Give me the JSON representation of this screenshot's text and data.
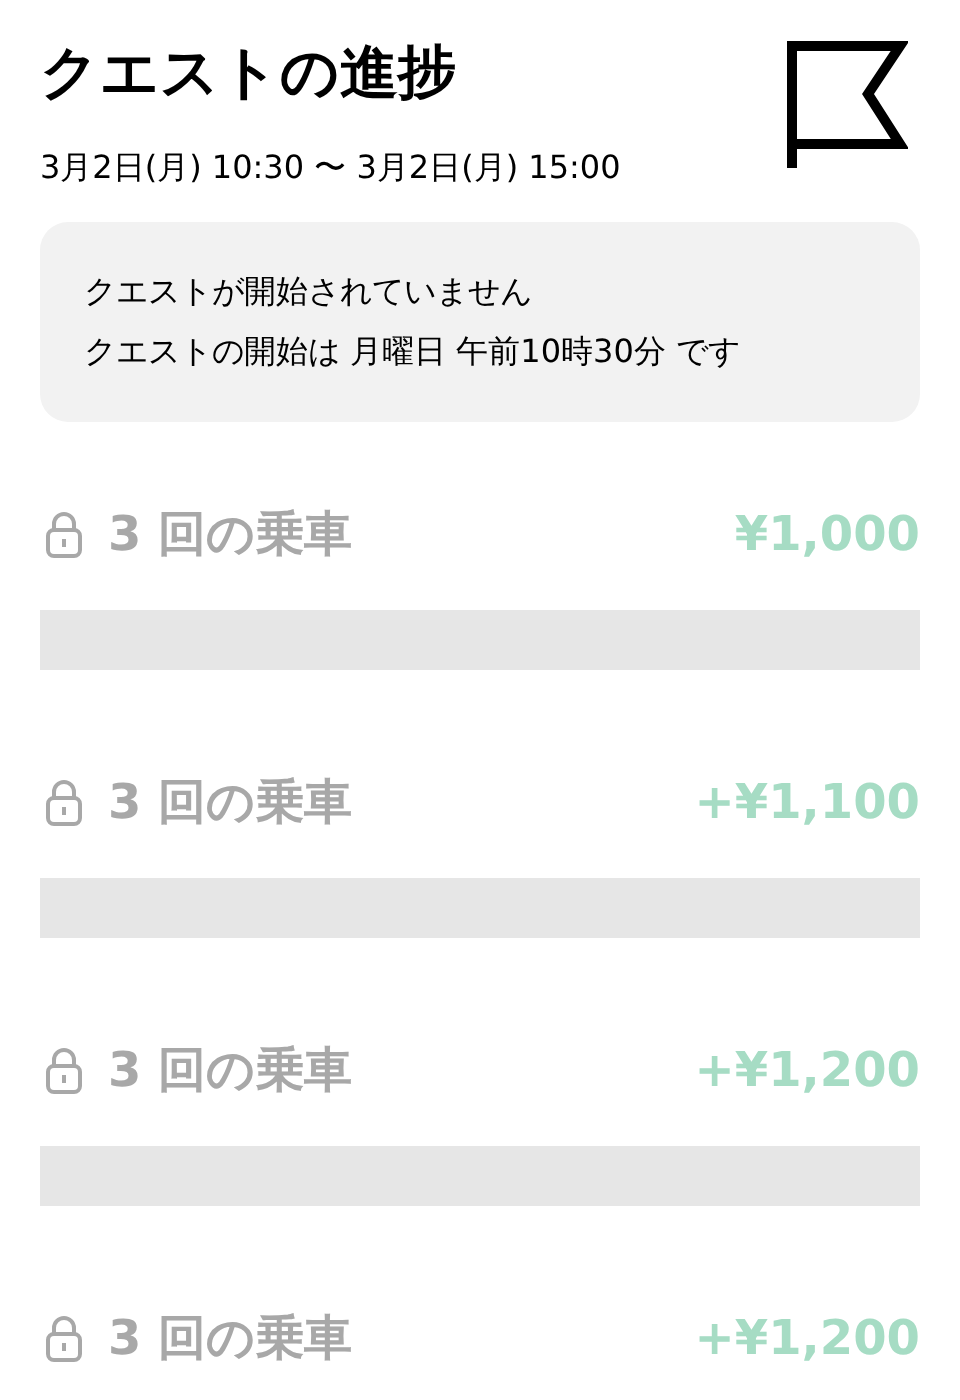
{
  "header": {
    "title": "クエストの進捗",
    "period": "3月2日(月) 10:30 〜 3月2日(月) 15:00"
  },
  "notice": {
    "heading": "クエストが開始されていません",
    "detail": "クエストの開始は 月曜日 午前10時30分 です"
  },
  "steps": [
    {
      "label": "3 回の乗車",
      "reward": "¥1,000",
      "locked": true,
      "level": 0
    },
    {
      "label": "3 回の乗車",
      "reward": "+¥1,100",
      "locked": true,
      "level": 0
    },
    {
      "label": "3 回の乗車",
      "reward": "+¥1,200",
      "locked": true,
      "level": 0
    },
    {
      "label": "3 回の乗車",
      "reward": "+¥1,200",
      "locked": true
    }
  ]
}
